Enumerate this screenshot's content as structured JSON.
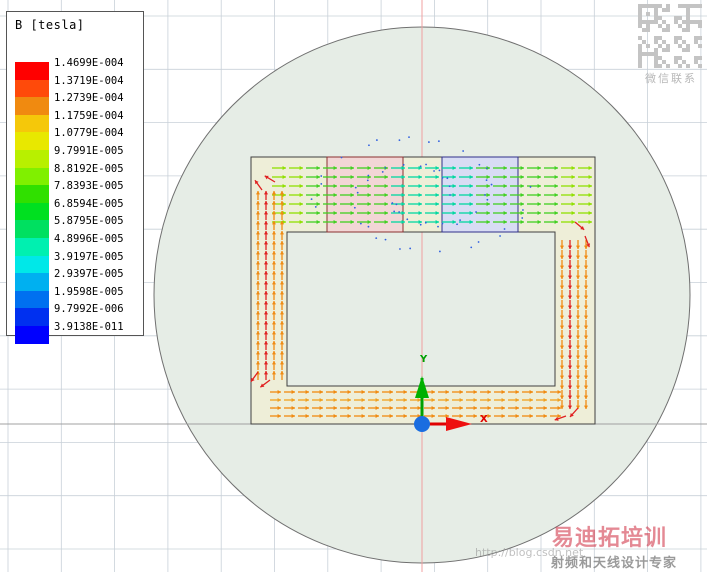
{
  "legend": {
    "title": "B [tesla]",
    "entries": [
      {
        "label": "1.4699E-004",
        "color": "#ff0000"
      },
      {
        "label": "1.3719E-004",
        "color": "#ff4a0a"
      },
      {
        "label": "1.2739E-004",
        "color": "#f08a10"
      },
      {
        "label": "1.1759E-004",
        "color": "#f5c80a"
      },
      {
        "label": "1.0779E-004",
        "color": "#e8e800"
      },
      {
        "label": "9.7991E-005",
        "color": "#b8f000"
      },
      {
        "label": "8.8192E-005",
        "color": "#80f000"
      },
      {
        "label": "7.8393E-005",
        "color": "#30e000"
      },
      {
        "label": "6.8594E-005",
        "color": "#00e020"
      },
      {
        "label": "5.8795E-005",
        "color": "#00e060"
      },
      {
        "label": "4.8996E-005",
        "color": "#00f0b0"
      },
      {
        "label": "3.9197E-005",
        "color": "#00e8e8"
      },
      {
        "label": "2.9397E-005",
        "color": "#00b0f0"
      },
      {
        "label": "1.9598E-005",
        "color": "#0070f0"
      },
      {
        "label": "9.7992E-006",
        "color": "#0030f0"
      },
      {
        "label": "3.9138E-011",
        "color": "#0000ff"
      }
    ]
  },
  "axes": {
    "y_label": "Y",
    "x_label": "X"
  },
  "watermark": {
    "qr_label": "微信联系",
    "brand": "易迪拓培训",
    "subtitle": "射频和天线设计专家",
    "url": "http://blog.csdn.net"
  },
  "colors": {
    "background": "#ffffff",
    "grid": "#c8d0d8",
    "region": "#e6ede6",
    "core": "#eeeed8",
    "coil_left": "#f2d6d6",
    "coil_right": "#d8dcf4",
    "axis_y": "#00a000",
    "axis_x": "#e00000",
    "origin": "#1a6de0"
  }
}
